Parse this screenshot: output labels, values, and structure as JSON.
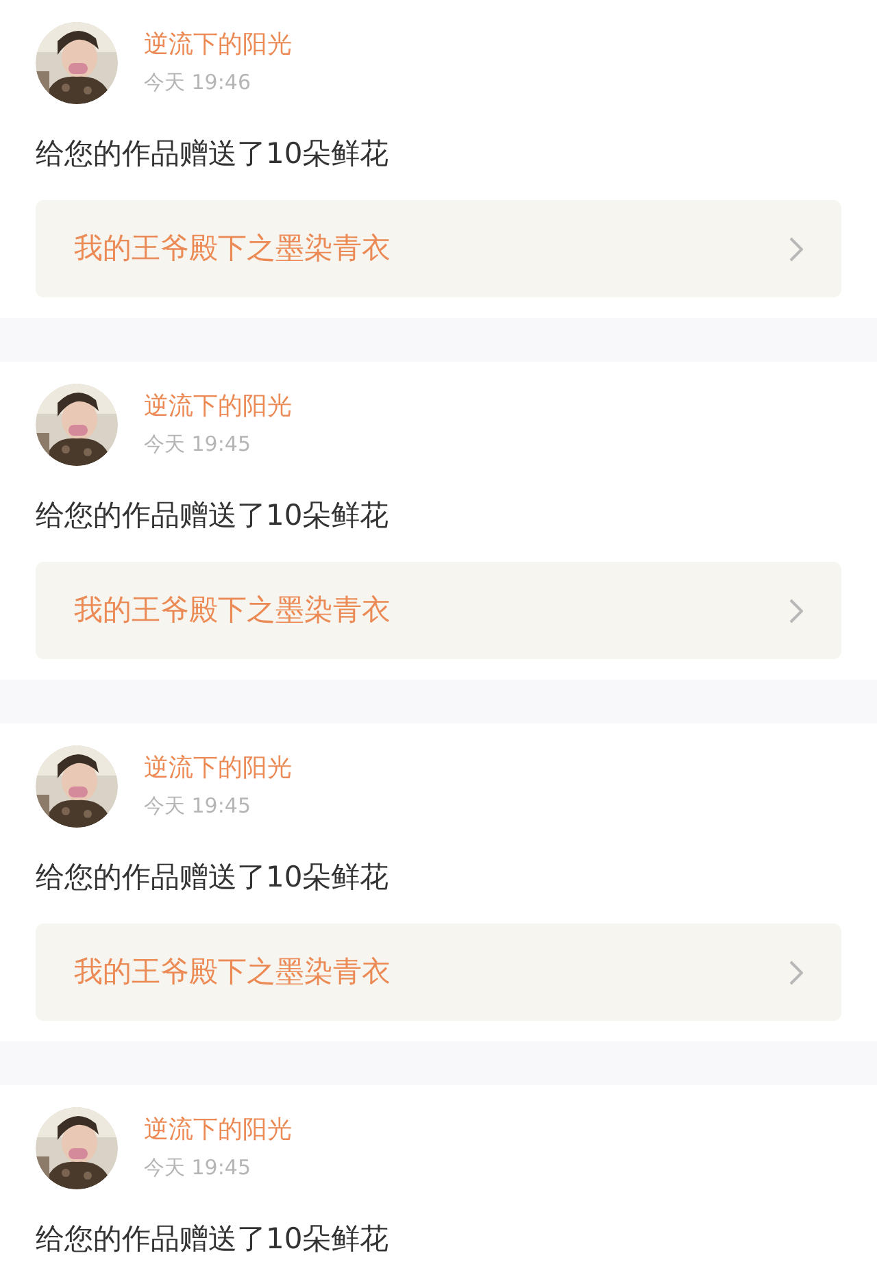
{
  "notifications": [
    {
      "user": "逆流下的阳光",
      "time": "今天 19:46",
      "message": "给您的作品赠送了10朵鲜花",
      "work": "我的王爷殿下之墨染青衣"
    },
    {
      "user": "逆流下的阳光",
      "time": "今天 19:45",
      "message": "给您的作品赠送了10朵鲜花",
      "work": "我的王爷殿下之墨染青衣"
    },
    {
      "user": "逆流下的阳光",
      "time": "今天 19:45",
      "message": "给您的作品赠送了10朵鲜花",
      "work": "我的王爷殿下之墨染青衣"
    },
    {
      "user": "逆流下的阳光",
      "time": "今天 19:45",
      "message": "给您的作品赠送了10朵鲜花"
    }
  ]
}
